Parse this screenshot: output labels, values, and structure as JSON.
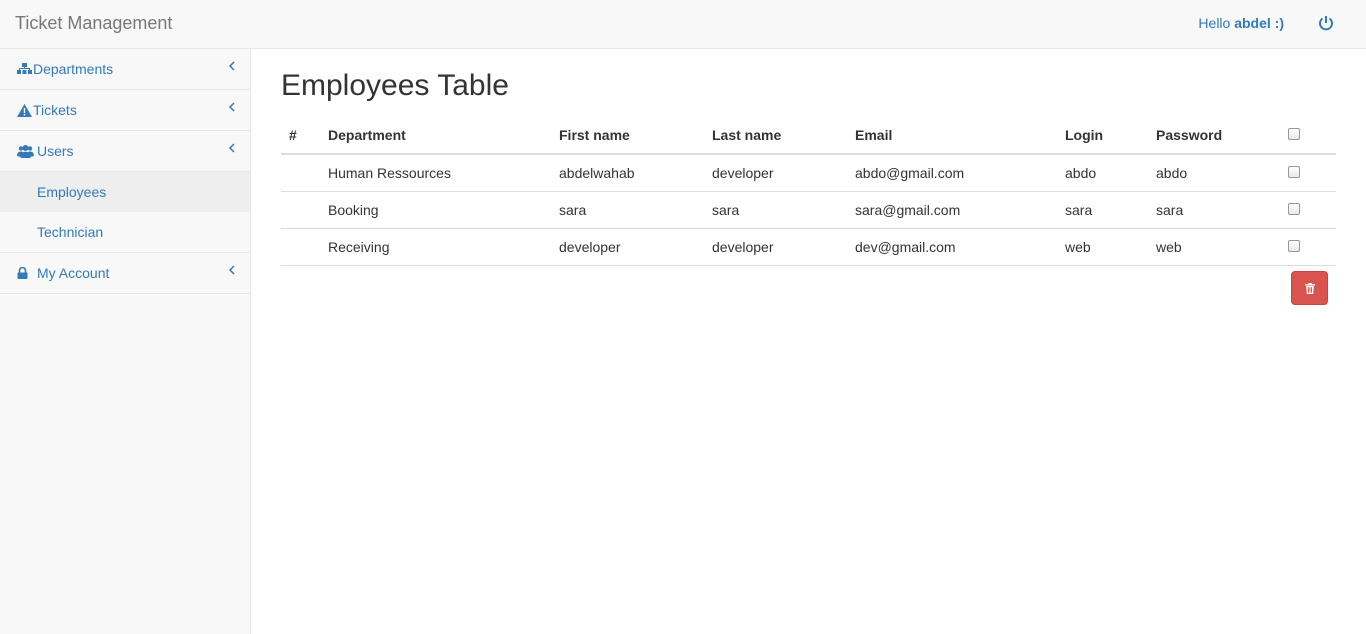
{
  "navbar": {
    "brand": "Ticket Management",
    "greeting_prefix": "Hello ",
    "username": "abdel :)",
    "logout_icon": "power-icon"
  },
  "sidebar": {
    "items": [
      {
        "label": "Departments",
        "icon": "sitemap-icon"
      },
      {
        "label": "Tickets",
        "icon": "warning-icon"
      },
      {
        "label": "Users",
        "icon": "users-icon",
        "children": [
          {
            "label": "Employees",
            "active": true
          },
          {
            "label": "Technician",
            "active": false
          }
        ]
      },
      {
        "label": "My Account",
        "icon": "lock-icon"
      }
    ]
  },
  "main": {
    "title": "Employees Table",
    "columns": [
      "#",
      "Department",
      "First name",
      "Last name",
      "Email",
      "Login",
      "Password"
    ],
    "rows": [
      {
        "num": "",
        "department": "Human Ressources",
        "first_name": "abdelwahab",
        "last_name": "developer",
        "email": "abdo@gmail.com",
        "login": "abdo",
        "password": "abdo"
      },
      {
        "num": "",
        "department": "Booking",
        "first_name": "sara",
        "last_name": "sara",
        "email": "sara@gmail.com",
        "login": "sara",
        "password": "sara"
      },
      {
        "num": "",
        "department": "Receiving",
        "first_name": "developer",
        "last_name": "developer",
        "email": "dev@gmail.com",
        "login": "web",
        "password": "web"
      }
    ],
    "delete_icon": "trash-icon",
    "colors": {
      "link": "#337ab7",
      "danger": "#d9534f"
    }
  }
}
